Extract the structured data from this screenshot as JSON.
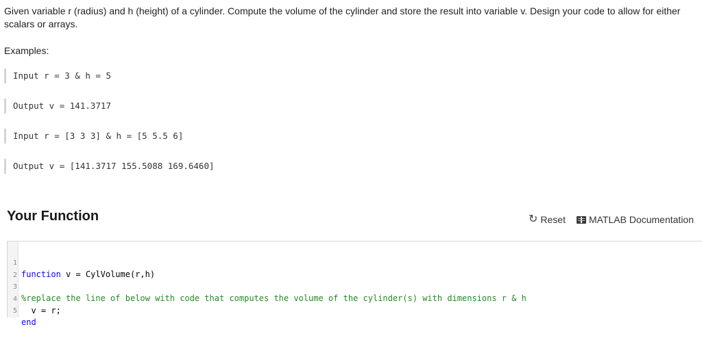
{
  "problem": {
    "description": "Given variable r (radius) and h (height) of a cylinder. Compute the volume of the cylinder and store the result into variable v. Design your code to allow for either scalars or arrays.",
    "examples_label": "Examples:",
    "examples": [
      "Input r = 3 & h = 5",
      "Output v = 141.3717",
      "Input r = [3 3 3] & h = [5 5.5 6]",
      "Output v = [141.3717 155.5088 169.6460]"
    ]
  },
  "function_section": {
    "title": "Your Function",
    "reset_label": "Reset",
    "docs_label": "MATLAB Documentation",
    "reset_icon": "reset-icon",
    "docs_icon": "book-icon"
  },
  "editor": {
    "line_numbers": [
      "1",
      "2",
      "3",
      "4",
      "5"
    ],
    "line1_keyword": "function",
    "line1_rest": " v = CylVolume(r,h)",
    "line2": "",
    "line3_comment": "%replace the line of below with code that computes the volume of the cylinder(s) with dimensions r & h",
    "line4": "  v = r;",
    "line5_keyword": "end",
    "colors": {
      "keyword": "#0e00ff",
      "comment": "#228b22"
    }
  }
}
